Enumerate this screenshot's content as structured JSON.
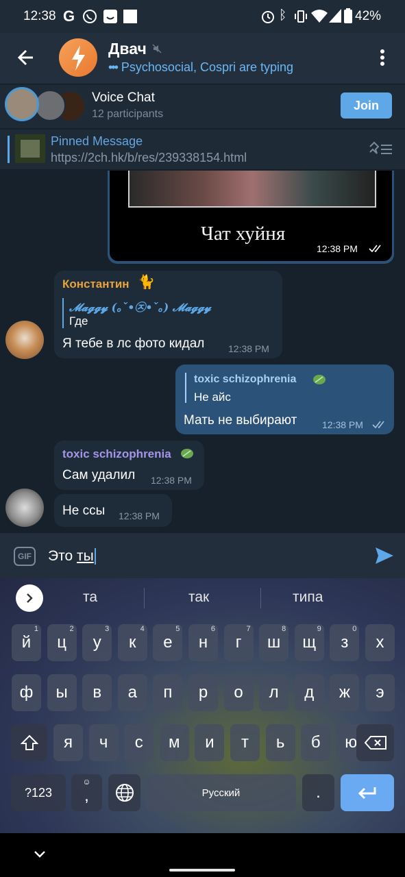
{
  "status": {
    "time": "12:38",
    "battery": "42%",
    "left_icons": [
      "google-icon",
      "whatsapp-icon",
      "smile-box-icon",
      "square-icon"
    ],
    "right_icons": [
      "alarm-icon",
      "bluetooth-icon",
      "vibrate-icon",
      "wifi-icon",
      "signal-icon",
      "battery-icon"
    ]
  },
  "header": {
    "title": "Двач",
    "typing_text": "Psychosocial, Cospri are typing",
    "typing_prefix": "•••"
  },
  "voice_chat": {
    "title": "Voice Chat",
    "participants": "12 participants",
    "join_label": "Join"
  },
  "pinned": {
    "title": "Pinned Message",
    "url": "https://2ch.hk/b/res/239338154.html"
  },
  "messages": [
    {
      "type": "image",
      "caption": "Чат хуйня",
      "time": "12:38 PM"
    },
    {
      "sender": "Константин",
      "reply_name": "𝓜𝓪𝓰𝓰𝔂 (｡ˇ•㉨•ˇ｡) 𝓜𝓪𝓰𝓰𝔂",
      "reply_text": "Где",
      "text": "Я тебе в лс фото кидал",
      "time": "12:38 PM"
    },
    {
      "reply_name": "toxic schizophrenia",
      "reply_text": "Не айс",
      "text": "Мать не выбирают",
      "time": "12:38 PM"
    },
    {
      "sender": "toxic schizophrenia",
      "text": "Сам удалил",
      "time": "12:38 PM"
    },
    {
      "text": "Не ссы",
      "time": "12:38 PM"
    }
  ],
  "composer": {
    "gif_label": "GIF",
    "text_prefix": "Это ",
    "text_underlined": "ты"
  },
  "keyboard": {
    "suggestions": [
      "та",
      "так",
      "типа"
    ],
    "row1": [
      "й",
      "ц",
      "у",
      "к",
      "е",
      "н",
      "г",
      "ш",
      "щ",
      "з",
      "х"
    ],
    "row1_nums": [
      "1",
      "2",
      "3",
      "4",
      "5",
      "6",
      "7",
      "8",
      "9",
      "0"
    ],
    "row2": [
      "ф",
      "ы",
      "в",
      "а",
      "п",
      "р",
      "о",
      "л",
      "д",
      "ж",
      "э"
    ],
    "row3": [
      "я",
      "ч",
      "с",
      "м",
      "и",
      "т",
      "ь",
      "б",
      "ю"
    ],
    "symbols_label": "?123",
    "comma": ",",
    "space_label": "Русский",
    "period": "."
  },
  "colors": {
    "accent": "#5fa8e7",
    "sender_konstantin": "#e8a33d",
    "sender_toxic": "#a695e7",
    "outgoing_bubble": "#2b5278",
    "incoming_bubble": "#1e2c3a"
  }
}
